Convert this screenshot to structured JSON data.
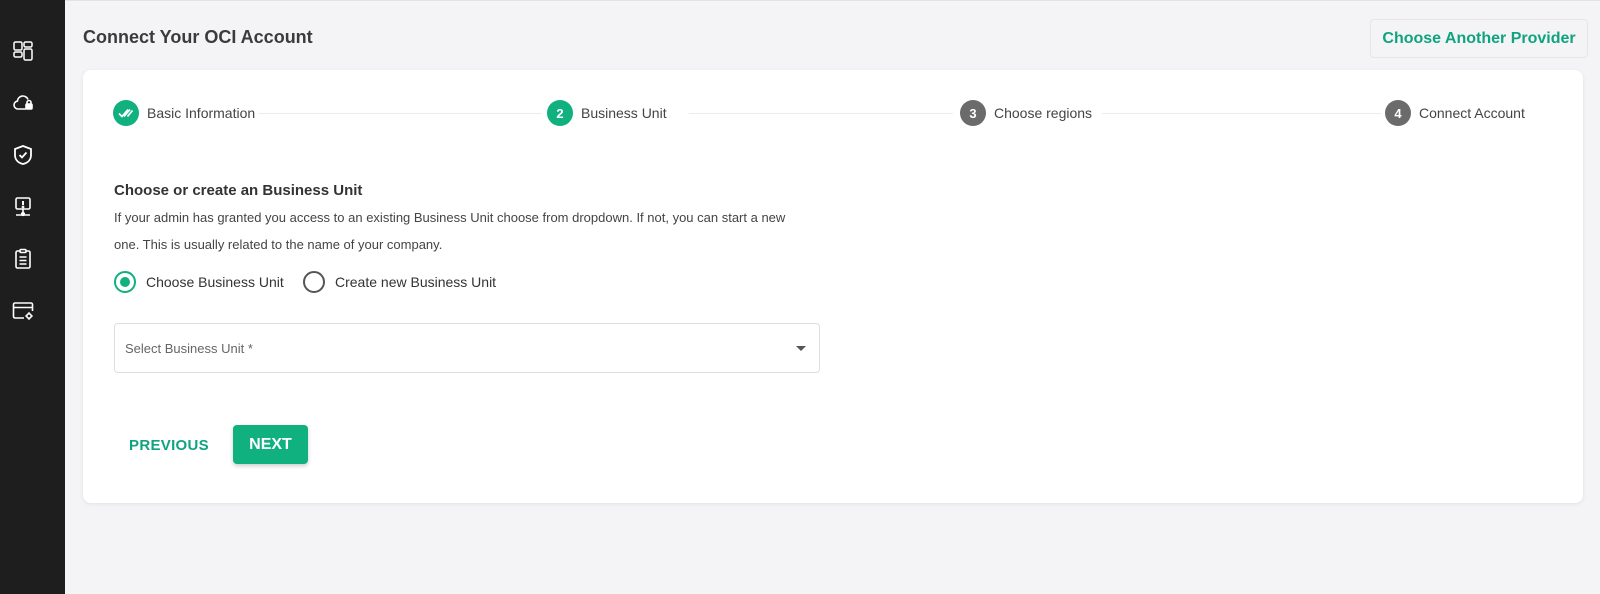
{
  "sidebar": {
    "icons": [
      "dashboard-icon",
      "cloud-lock-icon",
      "shield-check-icon",
      "monitor-alert-icon",
      "clipboard-icon",
      "browser-settings-icon"
    ]
  },
  "header": {
    "title": "Connect Your OCI Account",
    "provider_button": "Choose Another Provider"
  },
  "stepper": {
    "steps": [
      {
        "number": "",
        "label": "Basic Information",
        "status": "done"
      },
      {
        "number": "2",
        "label": "Business Unit",
        "status": "active"
      },
      {
        "number": "3",
        "label": "Choose regions",
        "status": "pending"
      },
      {
        "number": "4",
        "label": "Connect Account",
        "status": "pending"
      }
    ]
  },
  "form": {
    "title": "Choose or create an Business Unit",
    "description": "If your admin has granted you access to an existing Business Unit choose from dropdown. If not, you can start a new one. This is usually related to the name of your company.",
    "radio_choose": "Choose Business Unit",
    "radio_create": "Create new Business Unit",
    "selected_radio": "choose",
    "select_placeholder": "Select Business Unit *"
  },
  "actions": {
    "previous": "PREVIOUS",
    "next": "NEXT"
  },
  "colors": {
    "accent": "#10b07f",
    "sidebar": "#1e1e1e",
    "pending_step": "#6b6b6b"
  }
}
